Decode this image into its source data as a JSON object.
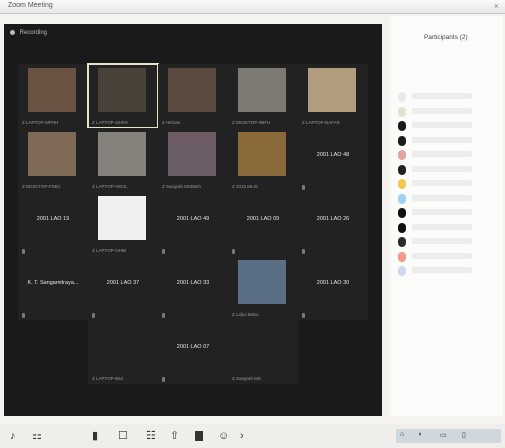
{
  "window": {
    "title": "Zoom Meeting"
  },
  "meeting_info": {
    "label": "Recording"
  },
  "participants_panel": {
    "title": "Participants (2)"
  },
  "tiles": [
    {
      "kind": "video",
      "name": "",
      "label": "Z LAPTOP-MPHH"
    },
    {
      "kind": "video",
      "name": "",
      "label": "Z LAPTOP-JSIRS",
      "active": true
    },
    {
      "kind": "video",
      "name": "",
      "label": "Z Hitman"
    },
    {
      "kind": "video",
      "name": "",
      "label": "Z DESKTOP-0BFU"
    },
    {
      "kind": "video",
      "name": "",
      "label": "Z LAPTOP-BAFAR"
    },
    {
      "kind": "video",
      "name": "",
      "label": "Z DESKTOP-FDB1"
    },
    {
      "kind": "video",
      "name": "",
      "label": "Z LAPTOP-V8CIL"
    },
    {
      "kind": "video",
      "name": "",
      "label": "Z Sangrah MSBWA"
    },
    {
      "kind": "video",
      "name": "",
      "label": "Z 2015 MLIS"
    },
    {
      "kind": "name",
      "name": "2001 LAO 48",
      "label": ""
    },
    {
      "kind": "name",
      "name": "2001 LAO 19",
      "label": ""
    },
    {
      "kind": "video",
      "name": "",
      "label": "Z LAPTOP-OHIB"
    },
    {
      "kind": "name",
      "name": "2001 LAO 49",
      "label": ""
    },
    {
      "kind": "name",
      "name": "2001 LAO 09",
      "label": ""
    },
    {
      "kind": "name",
      "name": "2001 LAO 26",
      "label": ""
    },
    {
      "kind": "name",
      "name": "K. T. Sangamitraya...",
      "label": ""
    },
    {
      "kind": "name",
      "name": "2001 LAO 37",
      "label": ""
    },
    {
      "kind": "name",
      "name": "2001 LAO 33",
      "label": ""
    },
    {
      "kind": "video",
      "name": "",
      "label": "Z Lidyo Babu"
    },
    {
      "kind": "name",
      "name": "2001 LAO 30",
      "label": ""
    },
    {
      "kind": "empty",
      "name": "",
      "label": "Z LAPTOP-B54"
    },
    {
      "kind": "name",
      "name": "2001 LAO 07",
      "label": ""
    },
    {
      "kind": "empty",
      "name": "",
      "label": "Z Sangrah MS"
    }
  ],
  "participant_avatars": [
    "#e9e9e9",
    "#dde5cc",
    "#1a1a1a",
    "#1a1a1a",
    "#e3a3a3",
    "#222222",
    "#f2c94c",
    "#9fd3f0",
    "#111111",
    "#111111",
    "#2b2b2b",
    "#f1998a",
    "#cfd9ec"
  ],
  "toolbar": {
    "items": [
      "mute-icon",
      "video-icon",
      "security-icon",
      "participants-icon",
      "chat-icon",
      "share-screen-icon",
      "record-icon",
      "reactions-icon",
      "more-icon"
    ]
  }
}
